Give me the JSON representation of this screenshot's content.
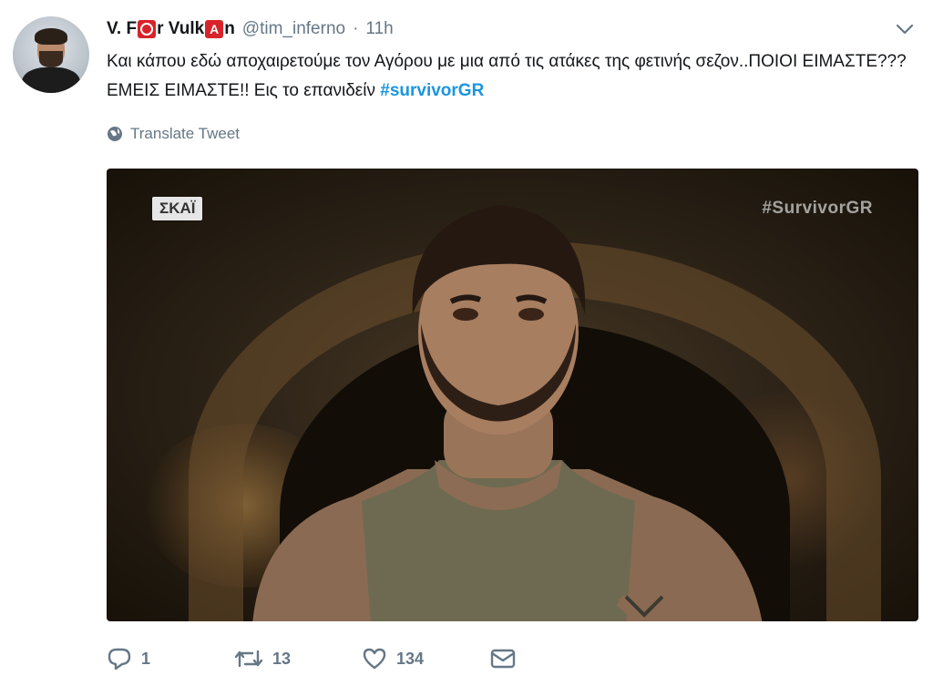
{
  "tweet": {
    "author_name_parts": [
      "V. F",
      "r Vulk",
      "n"
    ],
    "author_name_boxes": [
      "O",
      "A"
    ],
    "handle": "@tim_inferno",
    "separator": "·",
    "time": "11h",
    "text_main": "Και κάπου εδώ αποχαιρετούμε τον Αγόρου με μια από τις ατάκες της φετινής σεζον..ΠΟΙΟΙ ΕΙΜΑΣΤΕ???ΕΜΕΙΣ ΕΙΜΑΣΤΕ!! Εις το επανιδείν ",
    "hashtag": "#survivorGR",
    "translate_label": "Translate Tweet"
  },
  "media": {
    "channel_logo": "ΣΚΑΪ",
    "watermark": "#SurvivorGR"
  },
  "actions": {
    "reply_count": "1",
    "retweet_count": "13",
    "like_count": "134"
  },
  "icons": [
    "avatar",
    "caret-down-icon",
    "globe-icon",
    "reply-icon",
    "retweet-icon",
    "heart-icon",
    "message-icon"
  ],
  "colors": {
    "link": "#1b95e0",
    "muted": "#657786",
    "emoji_red": "#d8232a"
  }
}
